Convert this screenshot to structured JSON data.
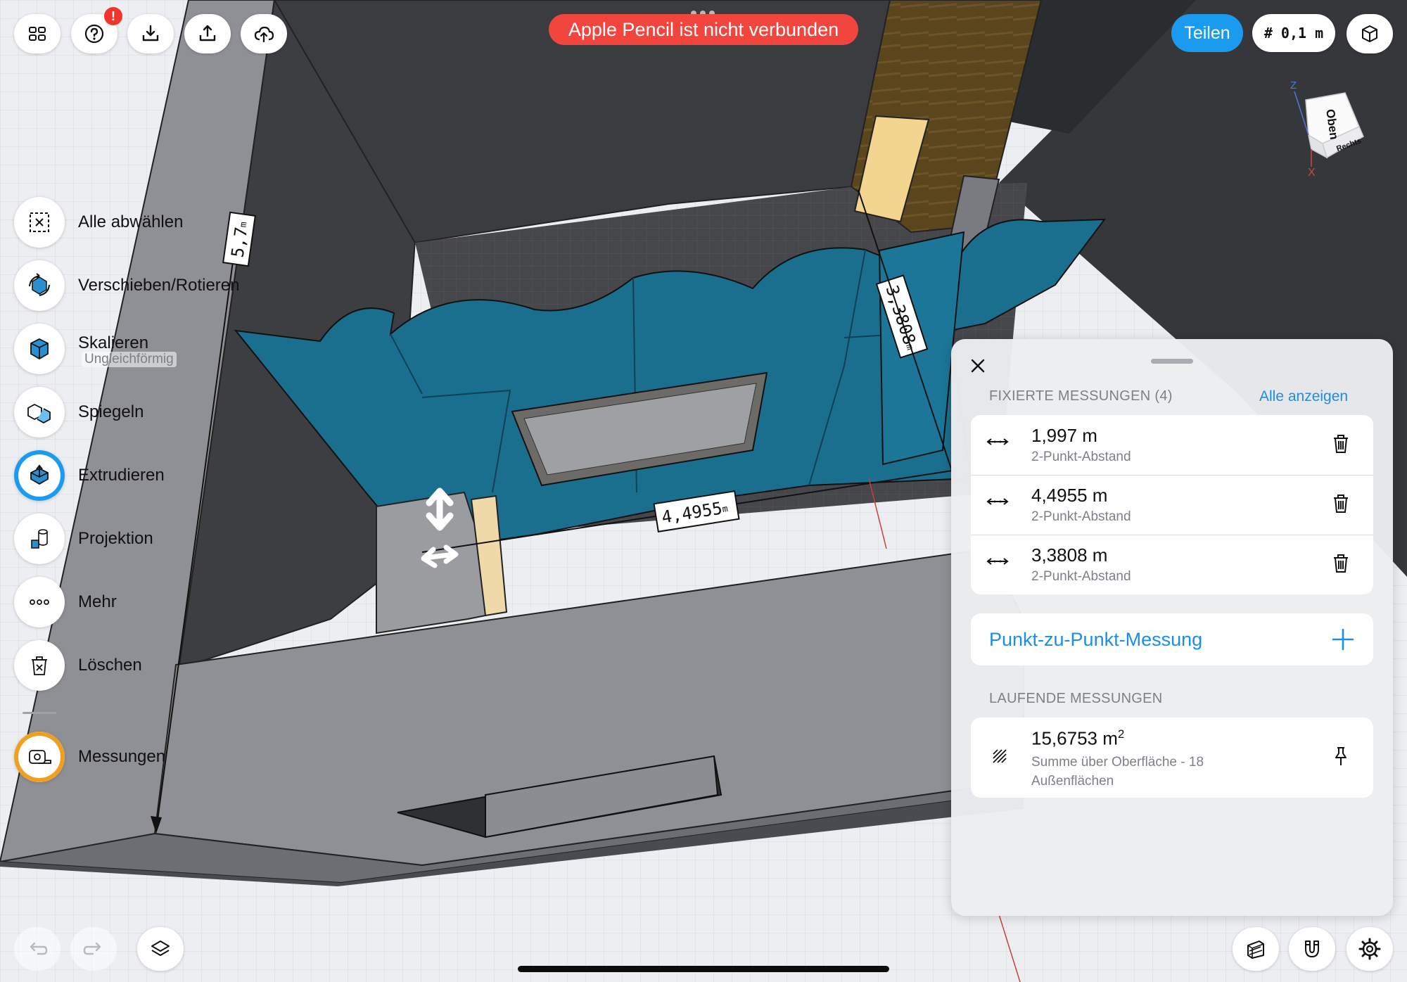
{
  "toolbar": {
    "alert_badge": "!",
    "pencil_banner": "Apple Pencil ist nicht verbunden",
    "share_label": "Teilen",
    "grid_label": "# 0,1 m"
  },
  "view_cube": {
    "top": "Oben",
    "right": "Rechts",
    "axis_z": "Z",
    "axis_x": "X"
  },
  "tools": [
    {
      "label": "Alle abwählen",
      "icon": "deselect-icon"
    },
    {
      "label": "Verschieben/Rotieren",
      "icon": "move-rotate-icon"
    },
    {
      "label": "Skalieren",
      "sublabel": "Ungleichförmig",
      "icon": "scale-icon"
    },
    {
      "label": "Spiegeln",
      "icon": "mirror-icon"
    },
    {
      "label": "Extrudieren",
      "icon": "extrude-icon"
    },
    {
      "label": "Projektion",
      "icon": "projection-icon"
    },
    {
      "label": "Mehr",
      "icon": "more-icon"
    },
    {
      "label": "Löschen",
      "icon": "delete-icon"
    },
    {
      "label": "Messungen",
      "icon": "tape-measure-icon"
    }
  ],
  "scene_labels": {
    "dim_left": "5,7",
    "dim_bottom": "4,4955",
    "dim_right": "3,3808",
    "unit": "m"
  },
  "panel": {
    "pinned_title": "FIXIERTE MESSUNGEN (4)",
    "show_all": "Alle anzeigen",
    "pinned": [
      {
        "value": "1,997 m",
        "type": "2-Punkt-Abstand"
      },
      {
        "value": "4,4955 m",
        "type": "2-Punkt-Abstand"
      },
      {
        "value": "3,3808 m",
        "type": "2-Punkt-Abstand"
      }
    ],
    "point_to_point": "Punkt-zu-Punkt-Messung",
    "running_title": "LAUFENDE MESSUNGEN",
    "running": {
      "value": "15,6753 m",
      "superscript": "2",
      "description": "Summe über Oberfläche - 18 Außenflächen"
    }
  },
  "colors": {
    "accent": "#1a9bf0",
    "banner_red": "#f2453d",
    "teal_wall": "#1a6f8e",
    "dark_wall": "#3c3d41",
    "gray_wall": "#8e8f94",
    "measure_ring": "#f0a020"
  }
}
